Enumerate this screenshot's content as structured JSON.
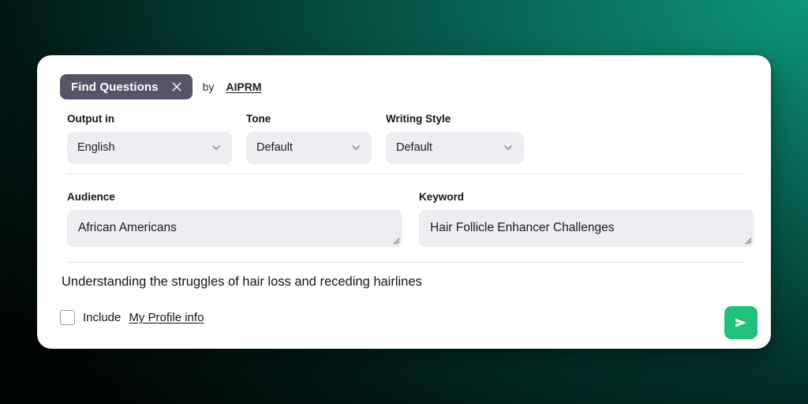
{
  "background": {
    "gradient_from": "#0d9678",
    "gradient_to": "#000604"
  },
  "card": {
    "header": {
      "chip_label": "Find Questions",
      "close_icon": "close-icon",
      "by_text": "by",
      "brand_link": "AIPRM"
    },
    "selects": [
      {
        "label": "Output in",
        "value": "English",
        "icon": "chevron-down-icon"
      },
      {
        "label": "Tone",
        "value": "Default",
        "icon": "chevron-down-icon"
      },
      {
        "label": "Writing Style",
        "value": "Default",
        "icon": "chevron-down-icon"
      }
    ],
    "textareas": [
      {
        "label": "Audience",
        "value": "African Americans",
        "placeholder": "Audience"
      },
      {
        "label": "Keyword",
        "value": "Hair Follicle Enhancer Challenges",
        "placeholder": "Keyword"
      }
    ],
    "prompt_text": "Understanding the struggles of hair loss and receding hairlines",
    "footer": {
      "checkbox_checked": false,
      "include_text": "Include",
      "profile_link": "My Profile info",
      "send_icon": "send-icon",
      "send_color": "#22c179"
    }
  }
}
